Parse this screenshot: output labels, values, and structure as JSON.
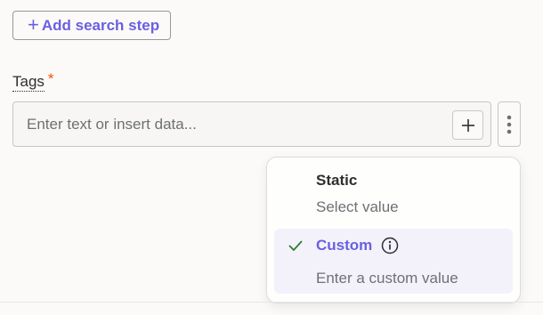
{
  "add_step": {
    "label": "Add search step"
  },
  "field": {
    "label": "Tags",
    "required_marker": "*",
    "placeholder": "Enter text or insert data..."
  },
  "menu": {
    "static": {
      "title": "Static",
      "subtitle": "Select value"
    },
    "custom": {
      "title": "Custom",
      "subtitle": "Enter a custom value",
      "selected": true
    }
  },
  "icons": {
    "add_step": "plus-icon",
    "insert": "plus-icon",
    "more": "vertical-dots-icon",
    "selected": "check-icon",
    "info": "info-circle-icon"
  },
  "colors": {
    "accent": "#6a5fe0",
    "required": "#ff4f00",
    "check": "#2e7d32"
  }
}
